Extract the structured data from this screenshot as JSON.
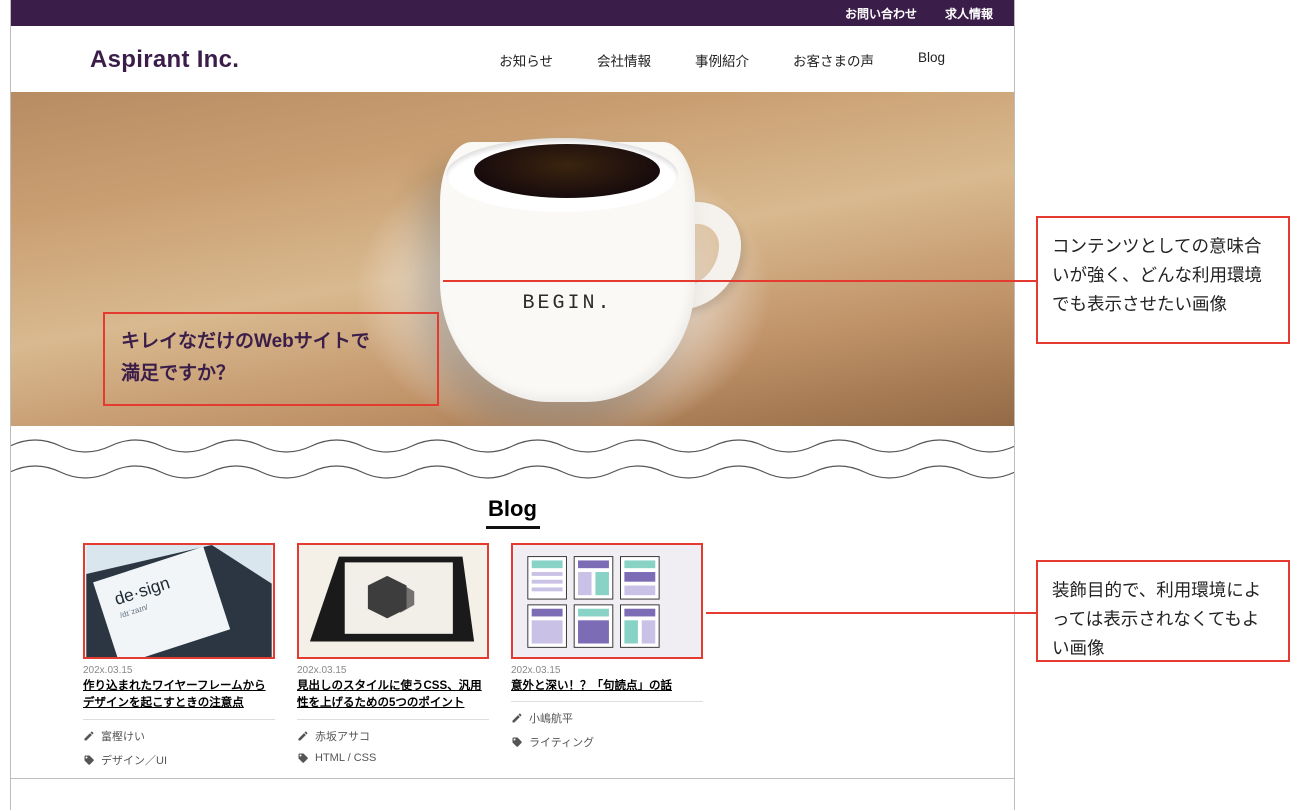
{
  "util_nav": {
    "contact": "お問い合わせ",
    "recruit": "求人情報"
  },
  "brand": "Aspirant Inc.",
  "nav": {
    "news": "お知らせ",
    "company": "会社情報",
    "works": "事例紹介",
    "voice": "お客さまの声",
    "blog": "Blog"
  },
  "hero": {
    "copy_line1": "キレイなだけのWebサイトで",
    "copy_line2": "満足ですか？",
    "mug_text": "BEGIN."
  },
  "blog": {
    "heading": "Blog",
    "cards": [
      {
        "date": "202x.03.15",
        "title": "作り込まれたワイヤーフレームからデザインを起こすときの注意点",
        "author": "富樫けい",
        "tag": "デザイン／UI"
      },
      {
        "date": "202x.03.15",
        "title": "見出しのスタイルに使うCSS、汎用性を上げるための5つのポイント",
        "author": "赤坂アサコ",
        "tag": "HTML / CSS"
      },
      {
        "date": "202x.03.15",
        "title": "意外と深い！？「句読点」の話",
        "author": "小嶋航平",
        "tag": "ライティング"
      }
    ]
  },
  "annotations": {
    "a1": "コンテンツとしての意味合いが強く、どんな利用環境でも表示させたい画像",
    "a2": "装飾目的で、利用環境によっては表示されなくてもよい画像"
  }
}
